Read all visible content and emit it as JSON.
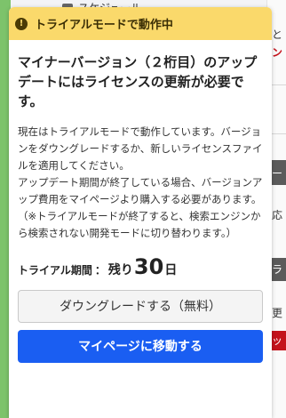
{
  "background": {
    "top_item_label": "スケジュール",
    "right_marks": [
      "と",
      "ン",
      "ー",
      "応",
      "ラ",
      "更",
      "ッ"
    ]
  },
  "dialog": {
    "banner_icon": "exclamation-icon",
    "banner_text": "トライアルモードで動作中",
    "title": "マイナーバージョン（２桁目）のアップデートにはライセンスの更新が必要です。",
    "paragraphs": [
      "現在はトライアルモードで動作しています。バージョンをダウングレードするか、新しいライセンスファイルを適用してください。",
      "アップデート期間が終了している場合、バージョンアップ費用をマイページより購入する必要があります。（※トライアルモードが終了すると、検索エンジンから検索されない開発モードに切り替わります。）"
    ],
    "trial_period": {
      "label": "トライアル期間",
      "separator": "：",
      "remaining_label": "残り",
      "days": "30",
      "unit": "日"
    },
    "downgrade_button": "ダウングレードする（無料）",
    "mypage_button": "マイページに移動する"
  },
  "colors": {
    "banner_bg": "#fad96b",
    "primary_button": "#1a5ef2",
    "accent_red": "#c4121b",
    "side_green": "#7dc36b"
  }
}
